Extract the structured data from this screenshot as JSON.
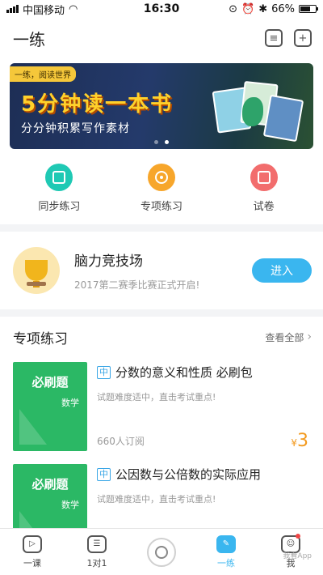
{
  "statusbar": {
    "carrier": "中国移动",
    "time": "16:30",
    "battery": "66%",
    "battery_level": 0.66
  },
  "header": {
    "title": "一练",
    "icons": [
      "filter-icon",
      "add-icon"
    ]
  },
  "banner": {
    "tag": "一练，阅读世界",
    "headline": "5分钟读一本书",
    "subline": "分分钟积累写作素材",
    "dots": 2,
    "active_dot": 1
  },
  "quick": [
    {
      "label": "同步练习",
      "icon": "sync-practice-icon",
      "color": "#1fc9b4"
    },
    {
      "label": "专项练习",
      "icon": "target-icon",
      "color": "#f7a62b"
    },
    {
      "label": "试卷",
      "icon": "exam-paper-icon",
      "color": "#f26d6d"
    }
  ],
  "arena": {
    "title": "脑力竞技场",
    "subtitle": "2017第二赛季比赛正式开启!",
    "button": "进入",
    "icon": "trophy-icon"
  },
  "section": {
    "title": "专项练习",
    "more": "查看全部"
  },
  "courses": [
    {
      "cover_title": "必刷题",
      "cover_subject": "数学",
      "badge": "中",
      "title": "分数的意义和性质 必刷包",
      "desc": "试题难度适中，直击考试重点!",
      "subs": "660人订阅",
      "price_symbol": "¥",
      "price": "3"
    },
    {
      "cover_title": "必刷题",
      "cover_subject": "数学",
      "badge": "中",
      "title": "公因数与公倍数的实际应用",
      "desc": "试题难度适中，直击考试重点!",
      "subs": "",
      "price_symbol": "",
      "price": ""
    }
  ],
  "tabs": [
    {
      "label": "一课",
      "icon": "video-lesson-icon",
      "glyph": "▷",
      "active": false
    },
    {
      "label": "1对1",
      "icon": "tutor-icon",
      "glyph": "☰",
      "active": false
    },
    {
      "label": "",
      "icon": "camera-icon",
      "glyph": "",
      "active": false
    },
    {
      "label": "一练",
      "icon": "practice-pen-icon",
      "glyph": "✎",
      "active": true
    },
    {
      "label": "我",
      "icon": "profile-icon",
      "glyph": "☺",
      "active": false
    }
  ],
  "watermark": "我看App"
}
